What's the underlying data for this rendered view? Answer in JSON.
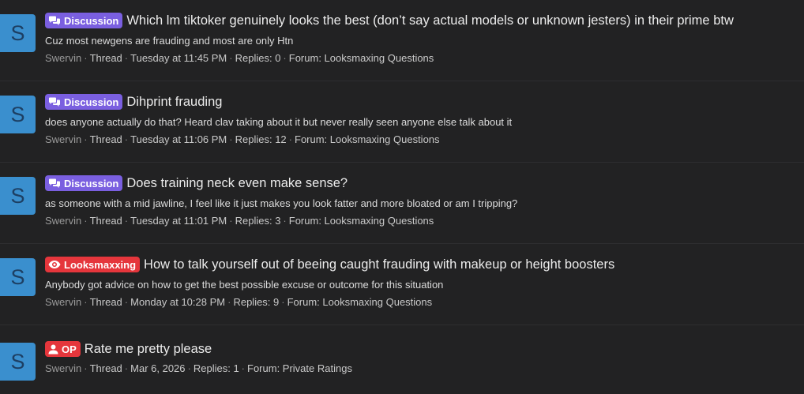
{
  "colors": {
    "discussion_badge": "#7a5fe0",
    "looksmaxxing_badge": "#e5363c",
    "op_badge": "#e5363c",
    "avatar_bg": "#3a8fce"
  },
  "threads": [
    {
      "avatar_letter": "S",
      "badge": {
        "label": "Discussion",
        "icon": "chat-bubbles-icon"
      },
      "title": "Which lm tiktoker genuinely looks the best (don’t say actual models or unknown jesters) in their prime btw",
      "snippet": "Cuz most newgens are frauding and most are only Htn",
      "author": "Swervin",
      "type": "Thread",
      "date": "Tuesday at 11:45 PM",
      "replies": "Replies: 0",
      "forum": "Forum: Looksmaxing Questions"
    },
    {
      "avatar_letter": "S",
      "badge": {
        "label": "Discussion",
        "icon": "chat-bubbles-icon"
      },
      "title": "Dihprint frauding",
      "snippet": "does anyone actually do that? Heard clav taking about it but never really seen anyone else talk about it",
      "author": "Swervin",
      "type": "Thread",
      "date": "Tuesday at 11:06 PM",
      "replies": "Replies: 12",
      "forum": "Forum: Looksmaxing Questions"
    },
    {
      "avatar_letter": "S",
      "badge": {
        "label": "Discussion",
        "icon": "chat-bubbles-icon"
      },
      "title": "Does training neck even make sense?",
      "snippet": "as someone with a mid jawline, I feel like it just makes you look fatter and more bloated or am I tripping?",
      "author": "Swervin",
      "type": "Thread",
      "date": "Tuesday at 11:01 PM",
      "replies": "Replies: 3",
      "forum": "Forum: Looksmaxing Questions"
    },
    {
      "avatar_letter": "S",
      "badge": {
        "label": "Looksmaxxing",
        "icon": "eye-icon"
      },
      "title": "How to talk yourself out of beeing caught frauding with makeup or height boosters",
      "snippet": "Anybody got advice on how to get the best possible excuse or outcome for this situation",
      "author": "Swervin",
      "type": "Thread",
      "date": "Monday at 10:28 PM",
      "replies": "Replies: 9",
      "forum": "Forum: Looksmaxing Questions"
    },
    {
      "avatar_letter": "S",
      "badge": {
        "label": "OP",
        "icon": "user-icon"
      },
      "title": "Rate me pretty please",
      "snippet": "",
      "author": "Swervin",
      "type": "Thread",
      "date": "Mar 6, 2026",
      "replies": "Replies: 1",
      "forum": "Forum: Private Ratings"
    }
  ]
}
